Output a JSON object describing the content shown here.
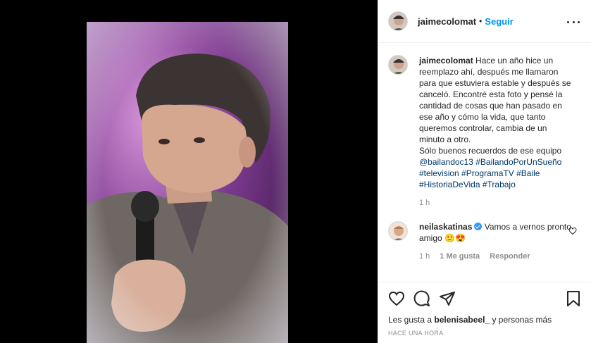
{
  "post": {
    "username": "jaimecolomat",
    "follow_label": "Seguir",
    "dot": "•"
  },
  "caption": {
    "username": "jaimecolomat",
    "text": " Hace un año hice un reemplazo ahí, después me llamaron para que estuviera estable y después se canceló. Encontré esta foto y pensé la cantidad de cosas que han pasado en ese año y cómo la vida, que tanto queremos controlar, cambia de un minuto a otro.\nSólo buenos recuerdos de ese equipo ",
    "mention": "@bailandoc13",
    "hashtags": [
      "#BailandoPorUnSueño",
      "#television",
      "#ProgramaTV",
      "#Baile",
      "#HistoriaDeVida",
      "#Trabajo"
    ],
    "time": "1 h"
  },
  "reply": {
    "username": "neilaskatinas",
    "text": " Vamos a vernos pronto amigo 🙂😍",
    "time": "1 h",
    "likes": "1 Me gusta",
    "reply_label": "Responder"
  },
  "likes": {
    "prefix": "Les gusta a ",
    "user": "belenisabeel_",
    "suffix": " y personas más"
  },
  "timestamp": "HACE UNA HORA",
  "colors": {
    "link": "#0095f6",
    "tag": "#00376b",
    "muted": "#8e8e8e",
    "verified": "#3897f0"
  }
}
